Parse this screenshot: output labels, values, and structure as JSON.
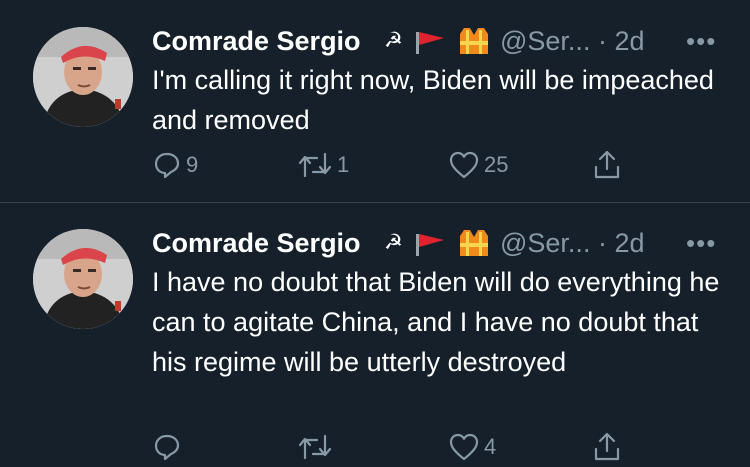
{
  "colors": {
    "background": "#15202b",
    "divider": "#38444d",
    "secondary_text": "#8899a6",
    "primary_text": "#ffffff"
  },
  "tweets": [
    {
      "author_name": "Comrade Sergio",
      "emoji_sickle": "☭",
      "emoji_icons": [
        "red-flag-icon",
        "safety-vest-icon"
      ],
      "handle": "@Ser...",
      "separator": "·",
      "time": "2d",
      "more": "•••",
      "text": "I'm calling it right now, Biden will be impeached and removed",
      "reply_count": "9",
      "retweet_count": "1",
      "like_count": "25",
      "share_count": ""
    },
    {
      "author_name": "Comrade Sergio",
      "emoji_sickle": "☭",
      "emoji_icons": [
        "red-flag-icon",
        "safety-vest-icon"
      ],
      "handle": "@Ser...",
      "separator": "·",
      "time": "2d",
      "more": "•••",
      "text": "I have no doubt that Biden will do everything he can to agitate China, and I have no doubt that his regime will be utterly destroyed",
      "reply_count": "",
      "retweet_count": "",
      "like_count": "4",
      "share_count": ""
    }
  ]
}
